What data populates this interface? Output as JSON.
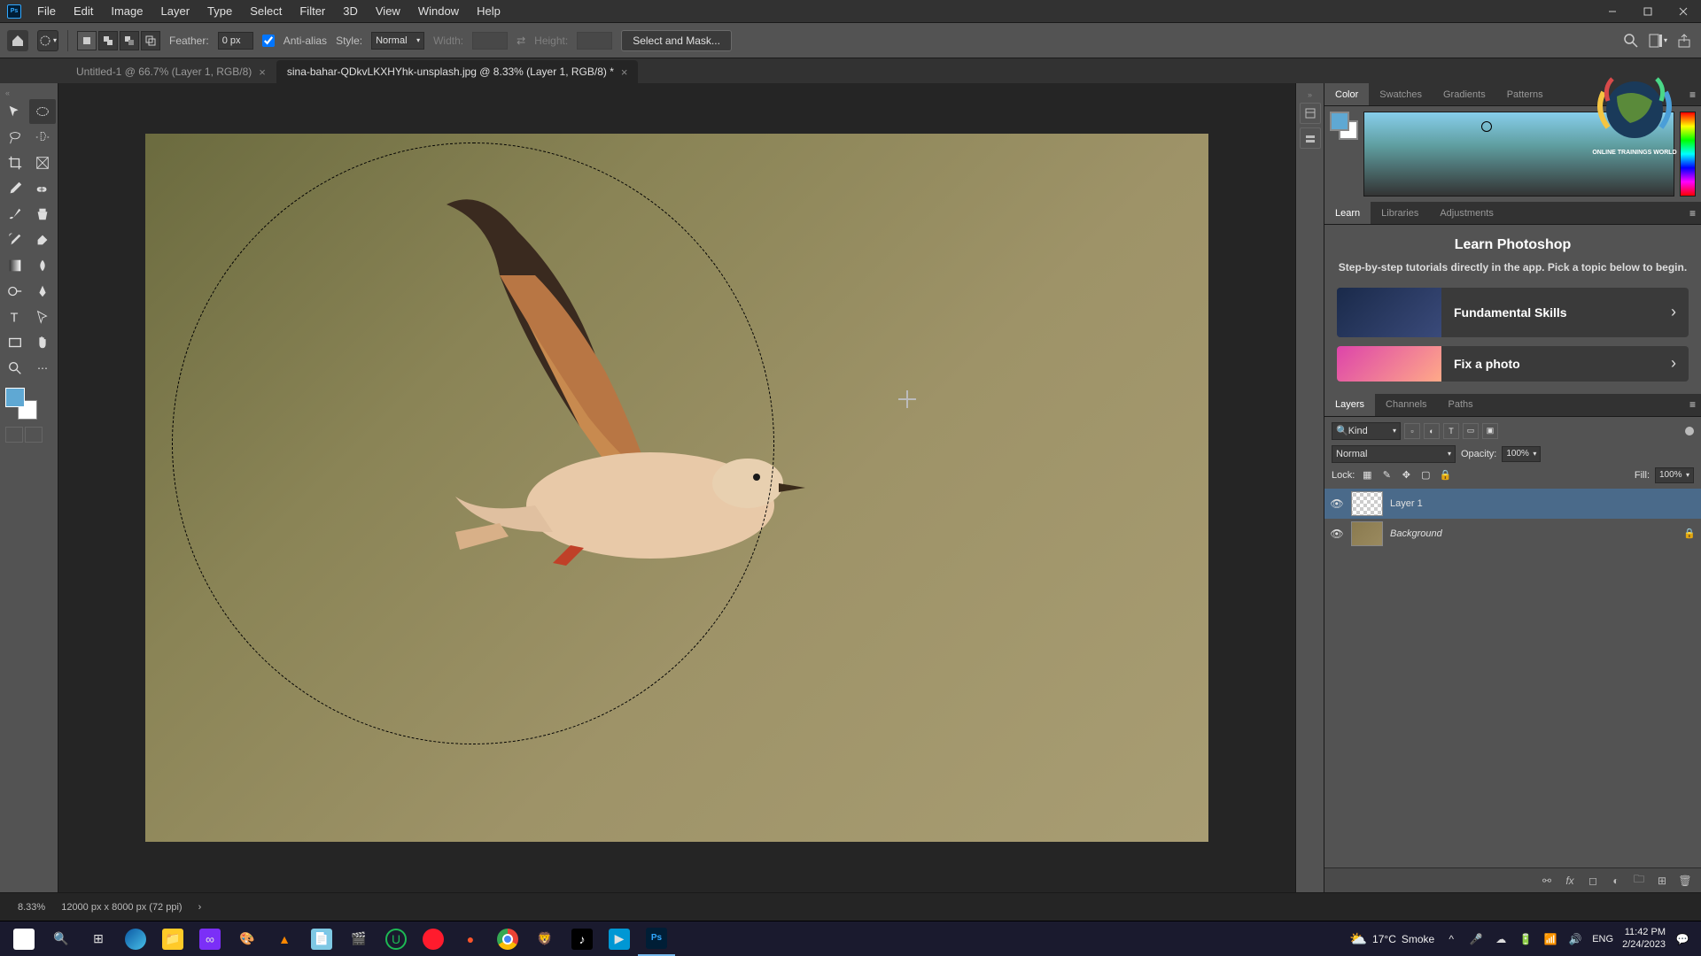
{
  "menu": {
    "items": [
      "File",
      "Edit",
      "Image",
      "Layer",
      "Type",
      "Select",
      "Filter",
      "3D",
      "View",
      "Window",
      "Help"
    ]
  },
  "options": {
    "feather_label": "Feather:",
    "feather_value": "0 px",
    "antialias_label": "Anti-alias",
    "style_label": "Style:",
    "style_value": "Normal",
    "width_label": "Width:",
    "height_label": "Height:",
    "select_mask_label": "Select and Mask..."
  },
  "tabs": [
    {
      "label": "Untitled-1 @ 66.7% (Layer 1, RGB/8)",
      "active": false
    },
    {
      "label": "sina-bahar-QDkvLKXHYhk-unsplash.jpg @ 8.33% (Layer 1, RGB/8) *",
      "active": true
    }
  ],
  "status": {
    "zoom": "8.33%",
    "dims": "12000 px x 8000 px (72 ppi)"
  },
  "color_panel": {
    "tabs": [
      "Color",
      "Swatches",
      "Gradients",
      "Patterns"
    ]
  },
  "learn_panel": {
    "tabs": [
      "Learn",
      "Libraries",
      "Adjustments"
    ],
    "title": "Learn Photoshop",
    "desc": "Step-by-step tutorials directly in the app. Pick a topic below to begin.",
    "cards": [
      {
        "title": "Fundamental Skills"
      },
      {
        "title": "Fix a photo"
      }
    ]
  },
  "layers_panel": {
    "tabs": [
      "Layers",
      "Channels",
      "Paths"
    ],
    "filter_label": "Kind",
    "blend_mode": "Normal",
    "opacity_label": "Opacity:",
    "opacity_value": "100%",
    "lock_label": "Lock:",
    "fill_label": "Fill:",
    "fill_value": "100%",
    "layers": [
      {
        "name": "Layer 1",
        "selected": true,
        "bg": false
      },
      {
        "name": "Background",
        "selected": false,
        "bg": true,
        "locked": true
      }
    ]
  },
  "overlay": {
    "brand": "ONLINE TRAININGS WORLD"
  },
  "taskbar": {
    "weather_temp": "17°C",
    "weather_cond": "Smoke",
    "lang": "ENG",
    "time": "11:42 PM",
    "date": "2/24/2023"
  }
}
